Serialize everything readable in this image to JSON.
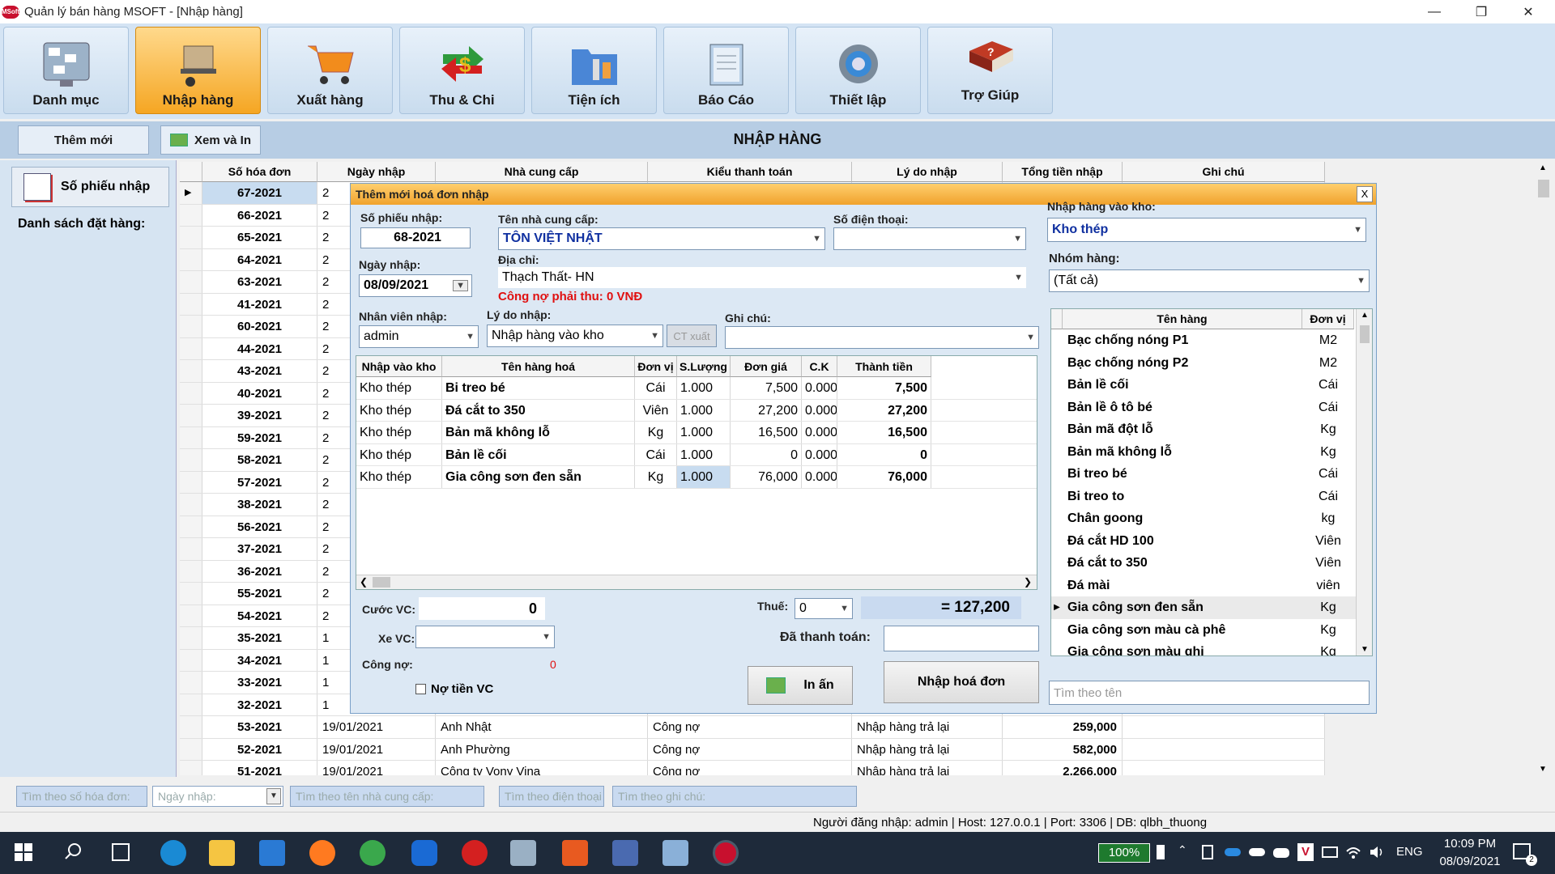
{
  "window": {
    "title": "Quản lý bán hàng MSOFT - [Nhập hàng]",
    "logo": "MSoft"
  },
  "toolbar": [
    {
      "label": "Danh mục",
      "icon": "catalog-icon"
    },
    {
      "label": "Nhập hàng",
      "icon": "import-goods-icon",
      "active": true
    },
    {
      "label": "Xuất hàng",
      "icon": "shopping-cart-icon"
    },
    {
      "label": "Thu & Chi",
      "icon": "money-exchange-icon"
    },
    {
      "label": "Tiện ích",
      "icon": "utilities-icon"
    },
    {
      "label": "Báo Cáo",
      "icon": "report-icon"
    },
    {
      "label": "Thiết lập",
      "icon": "settings-icon"
    },
    {
      "label": "Trợ Giúp",
      "icon": "help-book-icon"
    }
  ],
  "subbar": {
    "add_new": "Thêm mới",
    "view_print": "Xem và In",
    "title": "NHẬP HÀNG"
  },
  "left": {
    "receipt_btn": "Số phiếu nhập",
    "orders_label": "Danh sách đặt hàng:"
  },
  "grid": {
    "columns": [
      "Số hóa đơn",
      "Ngày nhập",
      "Nhà cung cấp",
      "Kiểu thanh toán",
      "Lý do nhập",
      "Tổng tiền nhập",
      "Ghi chú"
    ],
    "rows": [
      [
        "67-2021",
        "2",
        "",
        "",
        "",
        "",
        ""
      ],
      [
        "66-2021",
        "2",
        "",
        "",
        "",
        "",
        ""
      ],
      [
        "65-2021",
        "2",
        "",
        "",
        "",
        "",
        ""
      ],
      [
        "64-2021",
        "2",
        "",
        "",
        "",
        "",
        ""
      ],
      [
        "63-2021",
        "2",
        "",
        "",
        "",
        "",
        ""
      ],
      [
        "41-2021",
        "2",
        "",
        "",
        "",
        "",
        ""
      ],
      [
        "60-2021",
        "2",
        "",
        "",
        "",
        "",
        ""
      ],
      [
        "44-2021",
        "2",
        "",
        "",
        "",
        "",
        ""
      ],
      [
        "43-2021",
        "2",
        "",
        "",
        "",
        "",
        ""
      ],
      [
        "40-2021",
        "2",
        "",
        "",
        "",
        "",
        ""
      ],
      [
        "39-2021",
        "2",
        "",
        "",
        "",
        "",
        ""
      ],
      [
        "59-2021",
        "2",
        "",
        "",
        "",
        "",
        ""
      ],
      [
        "58-2021",
        "2",
        "",
        "",
        "",
        "",
        ""
      ],
      [
        "57-2021",
        "2",
        "",
        "",
        "",
        "",
        ""
      ],
      [
        "38-2021",
        "2",
        "",
        "",
        "",
        "",
        ""
      ],
      [
        "56-2021",
        "2",
        "",
        "",
        "",
        "",
        ""
      ],
      [
        "37-2021",
        "2",
        "",
        "",
        "",
        "",
        ""
      ],
      [
        "36-2021",
        "2",
        "",
        "",
        "",
        "",
        ""
      ],
      [
        "55-2021",
        "2",
        "",
        "",
        "",
        "",
        ""
      ],
      [
        "54-2021",
        "2",
        "",
        "",
        "",
        "",
        ""
      ],
      [
        "35-2021",
        "1",
        "",
        "",
        "",
        "",
        ""
      ],
      [
        "34-2021",
        "1",
        "",
        "",
        "",
        "",
        ""
      ],
      [
        "33-2021",
        "1",
        "",
        "",
        "",
        "",
        ""
      ],
      [
        "32-2021",
        "1",
        "",
        "",
        "",
        "",
        ""
      ],
      [
        "53-2021",
        "19/01/2021",
        "Anh Nhật",
        "Công nợ",
        "Nhập hàng trả lại",
        "259,000",
        ""
      ],
      [
        "52-2021",
        "19/01/2021",
        "Anh Phường",
        "Công nợ",
        "Nhập hàng trả lại",
        "582,000",
        ""
      ],
      [
        "51-2021",
        "19/01/2021",
        "Công ty Vony Vina",
        "Công nợ",
        "Nhập hàng trả lại",
        "2,266,000",
        ""
      ]
    ]
  },
  "dialog": {
    "title": "Thêm mới hoá đơn nhập",
    "close": "X",
    "receipt_no_label": "Số phiếu nhập:",
    "receipt_no": "68-2021",
    "date_label": "Ngày nhập:",
    "date": "08/09/2021",
    "supplier_label": "Tên nhà cung cấp:",
    "supplier": "TÔN VIỆT NHẬT",
    "phone_label": "Số điện thoại:",
    "phone": "",
    "address_label": "Địa chỉ:",
    "address": "Thạch Thất- HN",
    "debt_notice": "Công nợ phải thu: 0 VNĐ",
    "staff_label": "Nhân viên nhập:",
    "staff": "admin",
    "reason_label": "Lý do nhập:",
    "reason": "Nhập hàng vào kho",
    "ct_xuat": "CT xuất",
    "note_label": "Ghi chú:",
    "note": "",
    "item_columns": [
      "Nhập vào kho",
      "Tên hàng hoá",
      "Đơn vị",
      "S.Lượng",
      "Đơn giá",
      "C.K",
      "Thành tiền"
    ],
    "items": [
      [
        "Kho thép",
        "Bi treo bé",
        "Cái",
        "1.000",
        "7,500",
        "0.000",
        "7,500"
      ],
      [
        "Kho thép",
        "Đá cắt to 350",
        "Viên",
        "1.000",
        "27,200",
        "0.000",
        "27,200"
      ],
      [
        "Kho thép",
        "Bản mã không lỗ",
        "Kg",
        "1.000",
        "16,500",
        "0.000",
        "16,500"
      ],
      [
        "Kho thép",
        "Bản lề cối",
        "Cái",
        "1.000",
        "0",
        "0.000",
        "0"
      ],
      [
        "Kho thép",
        "Gia công sơn đen sẵn",
        "Kg",
        "1.000",
        "76,000",
        "0.000",
        "76,000"
      ]
    ],
    "freight_label": "Cước VC:",
    "freight": "0",
    "vehicle_label": "Xe VC:",
    "debt_label": "Công nợ:",
    "debt": "0",
    "owe_freight": "Nợ tiền VC",
    "tax_label": "Thuế:",
    "tax": "0",
    "total": "= 127,200",
    "paid_label": "Đã thanh toán:",
    "print_btn": "In ấn",
    "submit_btn": "Nhập hoá đơn"
  },
  "rpanel": {
    "warehouse_label": "Nhập hàng vào kho:",
    "warehouse": "Kho thép",
    "group_label": "Nhóm hàng:",
    "group": "(Tất cả)",
    "columns": [
      "Tên hàng",
      "Đơn vị"
    ],
    "products": [
      [
        "Bạc chống nóng P1",
        "M2"
      ],
      [
        "Bạc chống nóng P2",
        "M2"
      ],
      [
        "Bản lề cối",
        "Cái"
      ],
      [
        "Bản lề ô tô bé",
        "Cái"
      ],
      [
        "Bản mã đột lỗ",
        "Kg"
      ],
      [
        "Bản mã không lỗ",
        "Kg"
      ],
      [
        "Bi treo bé",
        "Cái"
      ],
      [
        "Bi treo to",
        "Cái"
      ],
      [
        "Chân goong",
        "kg"
      ],
      [
        "Đá cắt HD 100",
        "Viên"
      ],
      [
        "Đá cắt to 350",
        "Viên"
      ],
      [
        "Đá mài",
        "viên"
      ],
      [
        "Gia công sơn đen sẵn",
        "Kg"
      ],
      [
        "Gia công sơn màu cà phê",
        "Kg"
      ],
      [
        "Gia công sơn màu ghi",
        "Kg"
      ]
    ],
    "search_placeholder": "Tìm theo tên"
  },
  "search": {
    "by_no": "Tìm theo số hóa đơn:",
    "by_date": "Ngày nhập:",
    "by_supplier": "Tìm theo tên nhà cung cấp:",
    "by_phone": "Tìm theo điện thoại",
    "by_note": "Tìm theo ghi chú:"
  },
  "status": "Người đăng nhập: admin | Host: 127.0.0.1 | Port: 3306 | DB: qlbh_thuong",
  "taskbar": {
    "battery": "100%",
    "lang": "ENG",
    "time": "10:09 PM",
    "date": "08/09/2021",
    "notifications": "2"
  }
}
